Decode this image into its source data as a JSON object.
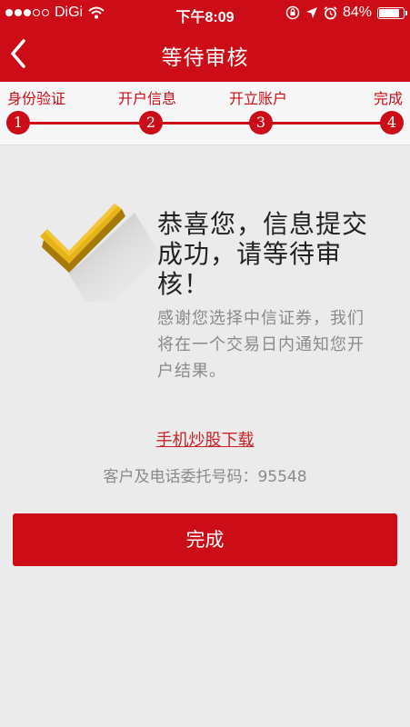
{
  "status_bar": {
    "carrier": "DiGi",
    "time": "下午8:09",
    "battery": "84%",
    "battery_level": 0.84
  },
  "nav": {
    "title": "等待审核",
    "back_icon": "chevron-left-icon"
  },
  "stepper": {
    "steps": [
      {
        "label": "身份验证",
        "number": "1"
      },
      {
        "label": "开户信息",
        "number": "2"
      },
      {
        "label": "开立账户",
        "number": "3"
      },
      {
        "label": "完成",
        "number": "4"
      }
    ]
  },
  "success": {
    "icon": "checkmark-icon",
    "title": "恭喜您，信息提交成功，请等待审核！",
    "description": "感谢您选择中信证券，我们将在一个交易日内通知您开户结果。"
  },
  "download_link": "手机炒股下载",
  "hotline": "客户及电话委托号码：95548",
  "done_button": "完成",
  "colors": {
    "brand_red": "#cc0c17",
    "check_gold": "#e7b416",
    "background": "#ebebeb"
  }
}
